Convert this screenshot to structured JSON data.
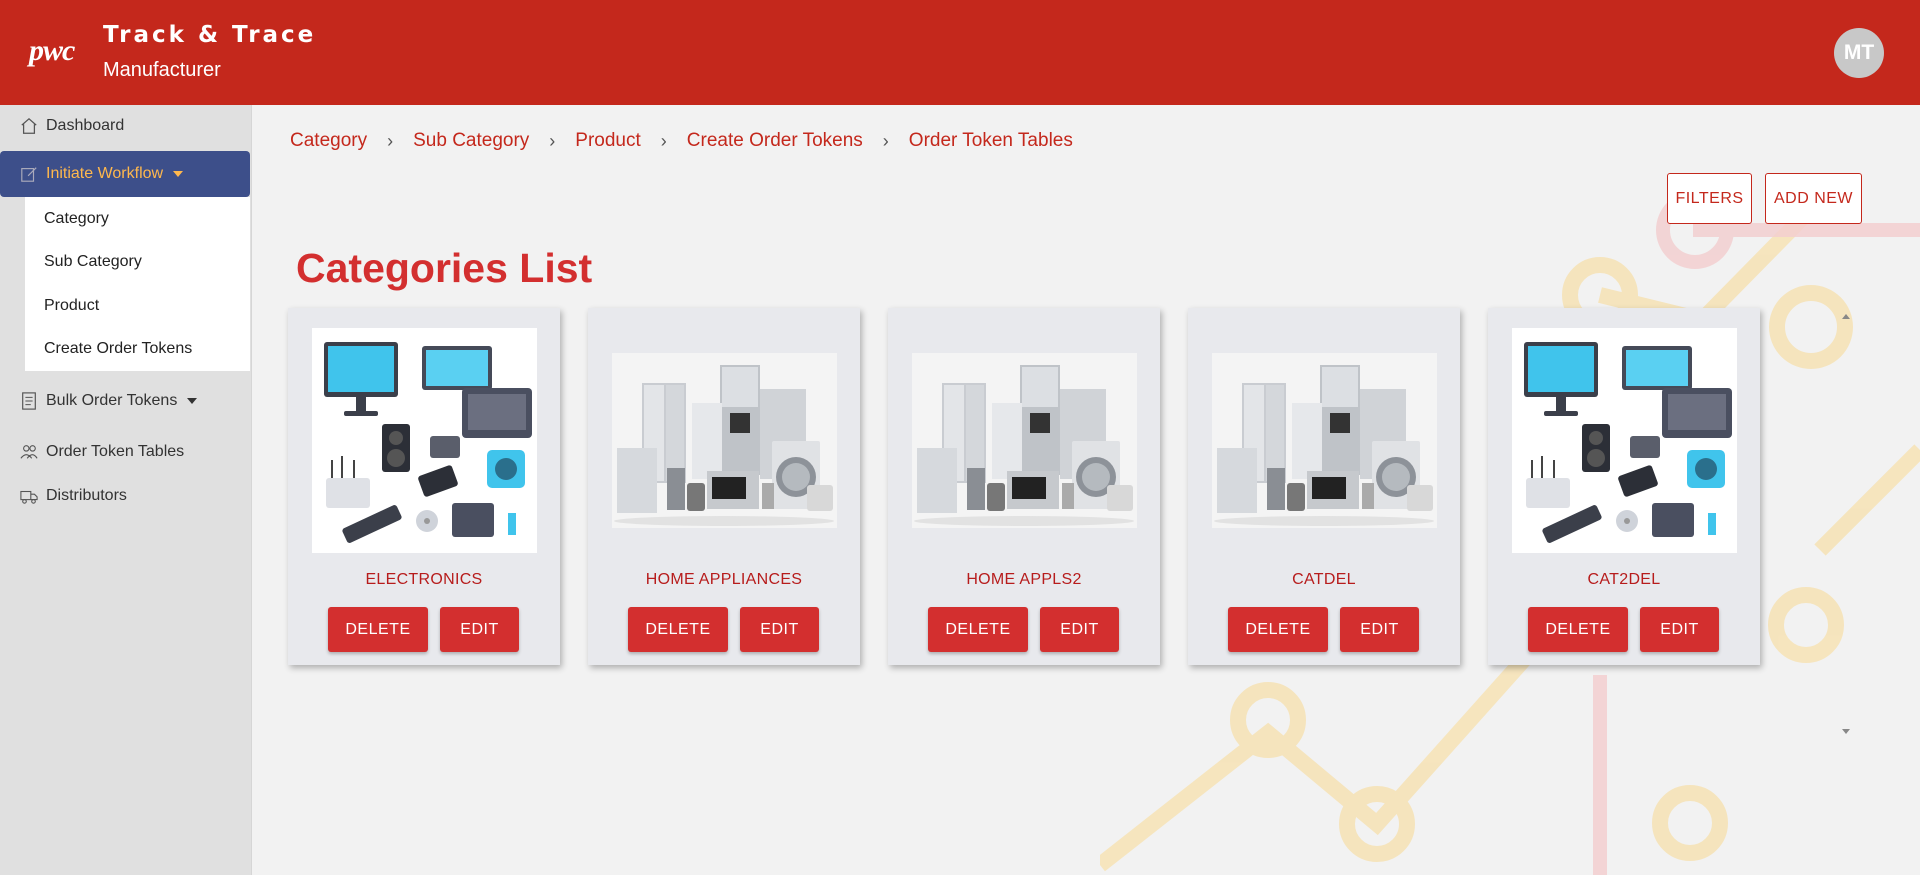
{
  "header": {
    "logo": "pwc",
    "title": "Track & Trace",
    "subtitle": "Manufacturer",
    "avatar_initials": "MT",
    "bg_color": "#c4281c"
  },
  "sidebar": {
    "items": [
      {
        "label": "Dashboard",
        "icon": "home-icon"
      },
      {
        "label": "Initiate Workflow",
        "icon": "edit-icon",
        "active": true,
        "expanded": true
      },
      {
        "label": "Bulk Order Tokens",
        "icon": "document-icon",
        "expandable": true
      },
      {
        "label": "Order Token Tables",
        "icon": "users-icon"
      },
      {
        "label": "Distributors",
        "icon": "truck-icon"
      }
    ],
    "submenu": [
      "Category",
      "Sub Category",
      "Product",
      "Create Order Tokens"
    ]
  },
  "breadcrumb": [
    "Category",
    "Sub Category",
    "Product",
    "Create Order Tokens",
    "Order Token Tables"
  ],
  "actions": {
    "filters_label": "FILTERS",
    "add_new_label": "ADD NEW"
  },
  "page": {
    "title": "Categories List"
  },
  "cards": [
    {
      "name": "ELECTRONICS",
      "image": "electronics",
      "delete_label": "DELETE",
      "edit_label": "EDIT"
    },
    {
      "name": "HOME APPLIANCES",
      "image": "appliances",
      "delete_label": "DELETE",
      "edit_label": "EDIT"
    },
    {
      "name": "HOME APPLS2",
      "image": "appliances",
      "delete_label": "DELETE",
      "edit_label": "EDIT"
    },
    {
      "name": "CATDEL",
      "image": "appliances",
      "delete_label": "DELETE",
      "edit_label": "EDIT"
    },
    {
      "name": "CAT2DEL",
      "image": "electronics",
      "delete_label": "DELETE",
      "edit_label": "EDIT"
    }
  ],
  "colors": {
    "primary": "#d32f2f",
    "nav_active": "#3d4f8a",
    "nav_active_text": "#ffb84d"
  }
}
